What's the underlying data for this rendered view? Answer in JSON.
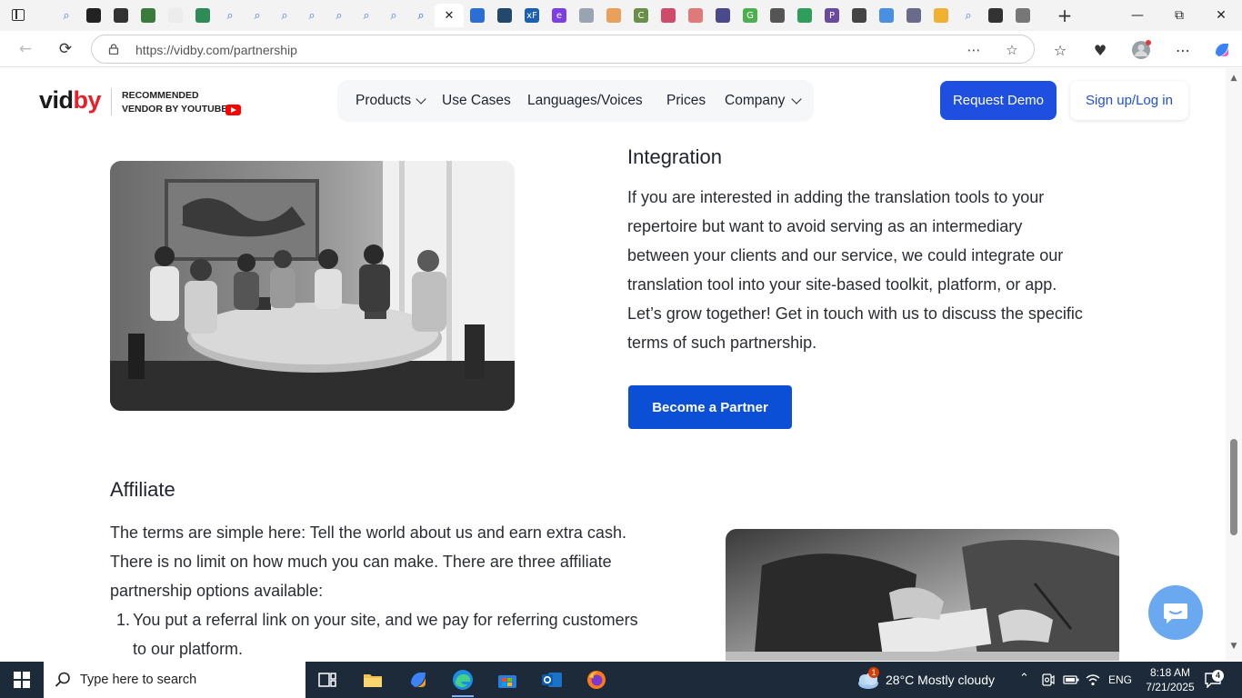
{
  "browser": {
    "tabs": [
      {
        "icon": "tab-actions-icon"
      },
      {
        "icon": "search-icon",
        "color": "#4a7bd8"
      },
      {
        "icon": "github-icon",
        "color": "#222222"
      },
      {
        "icon": "globe-icon",
        "color": "#333333"
      },
      {
        "icon": "chart-icon",
        "color": "#3a7a3a"
      },
      {
        "icon": "notion-icon",
        "color": "#ececec"
      },
      {
        "icon": "maps-icon",
        "color": "#2e8b57"
      },
      {
        "icon": "search-icon",
        "color": "#4a7bd8"
      },
      {
        "icon": "search-icon",
        "color": "#4a7bd8"
      },
      {
        "icon": "search-icon",
        "color": "#4a7bd8"
      },
      {
        "icon": "search-icon",
        "color": "#4a7bd8"
      },
      {
        "icon": "search-icon",
        "color": "#4a7bd8"
      },
      {
        "icon": "search-icon",
        "color": "#4a7bd8"
      },
      {
        "icon": "search-icon",
        "color": "#4a7bd8"
      },
      {
        "icon": "search-icon",
        "color": "#1a5fd0"
      },
      {
        "icon": "close-icon",
        "active": true
      },
      {
        "icon": "slides-icon",
        "color": "#2b6fd6"
      },
      {
        "icon": "paw-icon",
        "color": "#23486e"
      },
      {
        "icon": "xf-icon",
        "color": "#1a5fb4",
        "glyph": "xF"
      },
      {
        "icon": "e-icon",
        "color": "#7b3fe4",
        "glyph": "e"
      },
      {
        "icon": "gear-icon",
        "color": "#9aa3b0"
      },
      {
        "icon": "square-icon",
        "color": "#e8a05a"
      },
      {
        "icon": "c-icon",
        "color": "#6a8f4a",
        "glyph": "C"
      },
      {
        "icon": "loop-icon",
        "color": "#d04a6a"
      },
      {
        "icon": "dots-icon",
        "color": "#e07a7a"
      },
      {
        "icon": "chain-icon",
        "color": "#4a4a8a"
      },
      {
        "icon": "g-icon",
        "color": "#4caf50",
        "glyph": "G"
      },
      {
        "icon": "puzzle-icon",
        "color": "#555555"
      },
      {
        "icon": "leaf-icon",
        "color": "#2e9e5a"
      },
      {
        "icon": "p-icon",
        "color": "#6a4aa0",
        "glyph": "P"
      },
      {
        "icon": "spiral-icon",
        "color": "#444444"
      },
      {
        "icon": "ring-icon",
        "color": "#4a90e2"
      },
      {
        "icon": "star-icon",
        "color": "#6a6a8a"
      },
      {
        "icon": "bolt-icon",
        "color": "#f0b030"
      },
      {
        "icon": "search-icon",
        "color": "#4a7bd8"
      },
      {
        "icon": "layers-icon",
        "color": "#333333"
      },
      {
        "icon": "globe-icon",
        "color": "#777777"
      }
    ],
    "url_host": "https://vidby.com",
    "url_path": "/partnership"
  },
  "site": {
    "logo_left": "vid",
    "logo_right": "by",
    "vendor_line1": "RECOMMENDED",
    "vendor_line2": "VENDOR BY YOUTUBE",
    "nav": {
      "products": "Products",
      "use_cases": "Use Cases",
      "languages": "Languages/Voices",
      "prices": "Prices",
      "company": "Company"
    },
    "request_demo": "Request Demo",
    "signup": "Sign up/Log in"
  },
  "integration": {
    "heading": "Integration",
    "lines": [
      "If you are interested in adding the translation tools to your",
      "repertoire but want to avoid serving as an intermediary",
      "between your clients and our service, we could integrate our",
      "translation tool into your site-based toolkit, platform, or app.",
      "Let’s grow together! Get in touch with us to discuss the specific",
      "terms of such partnership."
    ],
    "button": "Become a Partner"
  },
  "affiliate": {
    "heading": "Affiliate",
    "lines": [
      "The terms are simple here: Tell the world about us and earn extra cash.",
      "There is no limit on how much you can make. There are three affiliate",
      "partnership options available:"
    ],
    "item1_number": "1.",
    "item1_line1": "You put a referral link on your site, and we pay for referring customers",
    "item1_line2": "to our platform."
  },
  "taskbar": {
    "search_placeholder": "Type here to search",
    "weather": "28°C  Mostly cloudy",
    "weather_badge": "1",
    "language": "ENG",
    "time": "8:18 AM",
    "date": "7/21/2025",
    "notifications": "4"
  }
}
